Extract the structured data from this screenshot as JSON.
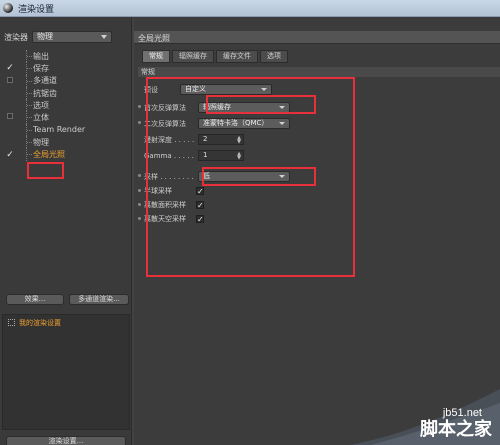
{
  "window": {
    "title": "渲染设置"
  },
  "renderer": {
    "label": "渲染器",
    "value": "物理"
  },
  "settings_list": [
    {
      "label": "输出",
      "checked": false,
      "has_box": false
    },
    {
      "label": "保存",
      "checked": true,
      "has_box": false
    },
    {
      "label": "多通道",
      "checked": false,
      "has_box": true
    },
    {
      "label": "抗锯齿",
      "checked": false,
      "has_box": false
    },
    {
      "label": "选项",
      "checked": false,
      "has_box": false
    },
    {
      "label": "立体",
      "checked": false,
      "has_box": true
    },
    {
      "label": "Team Render",
      "checked": false,
      "has_box": false
    },
    {
      "label": "物理",
      "checked": false,
      "has_box": false
    },
    {
      "label": "全局光照",
      "checked": true,
      "has_box": false,
      "active": true
    }
  ],
  "buttons": {
    "effects": "效果...",
    "multipass_render": "多通道渲染..."
  },
  "presets": {
    "my_render_setting": "我的渲染设置"
  },
  "bottom_button": "渲染设置...",
  "panel": {
    "title": "全局光照",
    "tabs": [
      "常规",
      "辐照缓存",
      "缓存文件",
      "选项"
    ],
    "active_tab": 0,
    "section": "常规",
    "preset": {
      "label": "预设",
      "value": "自定义"
    },
    "primary_method": {
      "label": "首次反弹算法",
      "value": "辐照缓存"
    },
    "secondary_method": {
      "label": "二次反弹算法",
      "value": "准蒙特卡洛（QMC）"
    },
    "diffuse_depth": {
      "label": "漫射深度 . . . . .",
      "value": "2"
    },
    "gamma": {
      "label": "Gamma . . . . . .",
      "value": "1"
    },
    "sampling": {
      "label": "采样 . . . . . . . .",
      "value": "低"
    },
    "hemisphere": {
      "label": "半球采样",
      "checked": true
    },
    "area_light": {
      "label": "离散面积采样",
      "checked": true
    },
    "sky_light": {
      "label": "离散天空采样",
      "checked": true
    }
  },
  "watermark": {
    "url": "jb51.net",
    "name": "脚本之家"
  },
  "colors": {
    "highlight": "#e8303a",
    "active_text": "#f0a030"
  }
}
